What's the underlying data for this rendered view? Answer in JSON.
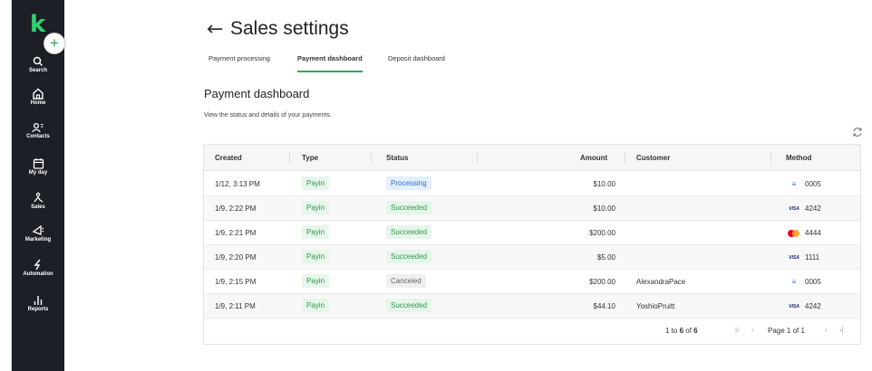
{
  "app": {
    "logo": "k",
    "new_button": "+"
  },
  "sidebar": {
    "items": [
      {
        "label": "Search",
        "icon": "search-icon"
      },
      {
        "label": "Home",
        "icon": "home-icon"
      },
      {
        "label": "Contacts",
        "icon": "contacts-icon"
      },
      {
        "label": "My day",
        "icon": "calendar-icon"
      },
      {
        "label": "Sales",
        "icon": "sales-icon"
      },
      {
        "label": "Marketing",
        "icon": "marketing-icon"
      },
      {
        "label": "Automation",
        "icon": "automation-icon"
      },
      {
        "label": "Reports",
        "icon": "reports-icon"
      }
    ]
  },
  "header": {
    "back_icon": "←",
    "title": "Sales settings"
  },
  "tabs": [
    {
      "label": "Payment processing",
      "active": false
    },
    {
      "label": "Payment dashboard",
      "active": true
    },
    {
      "label": "Deposit dashboard",
      "active": false
    }
  ],
  "section": {
    "title": "Payment dashboard",
    "description": "View the status and details of your payments."
  },
  "table": {
    "columns": [
      "Created",
      "Type",
      "Status",
      "Amount",
      "Customer",
      "Method"
    ],
    "rows": [
      {
        "created": "1/12, 3:13 PM",
        "type": "Payin",
        "status": "Processing",
        "status_kind": "processing",
        "amount": "$10.00",
        "customer": "",
        "method_icon": "bank",
        "method_last4": "0005"
      },
      {
        "created": "1/9, 2:22 PM",
        "type": "Payin",
        "status": "Succeeded",
        "status_kind": "succeeded",
        "amount": "$10.00",
        "customer": "",
        "method_icon": "visa",
        "method_last4": "4242"
      },
      {
        "created": "1/9, 2:21 PM",
        "type": "Payin",
        "status": "Succeeded",
        "status_kind": "succeeded",
        "amount": "$200.00",
        "customer": "",
        "method_icon": "mastercard",
        "method_last4": "4444"
      },
      {
        "created": "1/9, 2:20 PM",
        "type": "Payin",
        "status": "Succeeded",
        "status_kind": "succeeded",
        "amount": "$5.00",
        "customer": "",
        "method_icon": "visa",
        "method_last4": "1111"
      },
      {
        "created": "1/9, 2:15 PM",
        "type": "Payin",
        "status": "Canceled",
        "status_kind": "canceled",
        "amount": "$200.00",
        "customer": "AlexandraPace",
        "method_icon": "bank",
        "method_last4": "0005"
      },
      {
        "created": "1/9, 2:11 PM",
        "type": "Payin",
        "status": "Succeeded",
        "status_kind": "succeeded",
        "amount": "$44.10",
        "customer": "YoshioPruitt",
        "method_icon": "visa",
        "method_last4": "4242"
      }
    ]
  },
  "pagination": {
    "range_prefix": "1 to ",
    "range_end": "6",
    "range_of": " of ",
    "range_total": "6",
    "page_text": "Page 1 of 1",
    "first": "|‹",
    "prev": "‹",
    "next": "›",
    "last": "›|"
  },
  "colors": {
    "sidebar_bg": "#1c1f26",
    "brand_green": "#2ed36b",
    "tab_underline": "#27ae60"
  }
}
